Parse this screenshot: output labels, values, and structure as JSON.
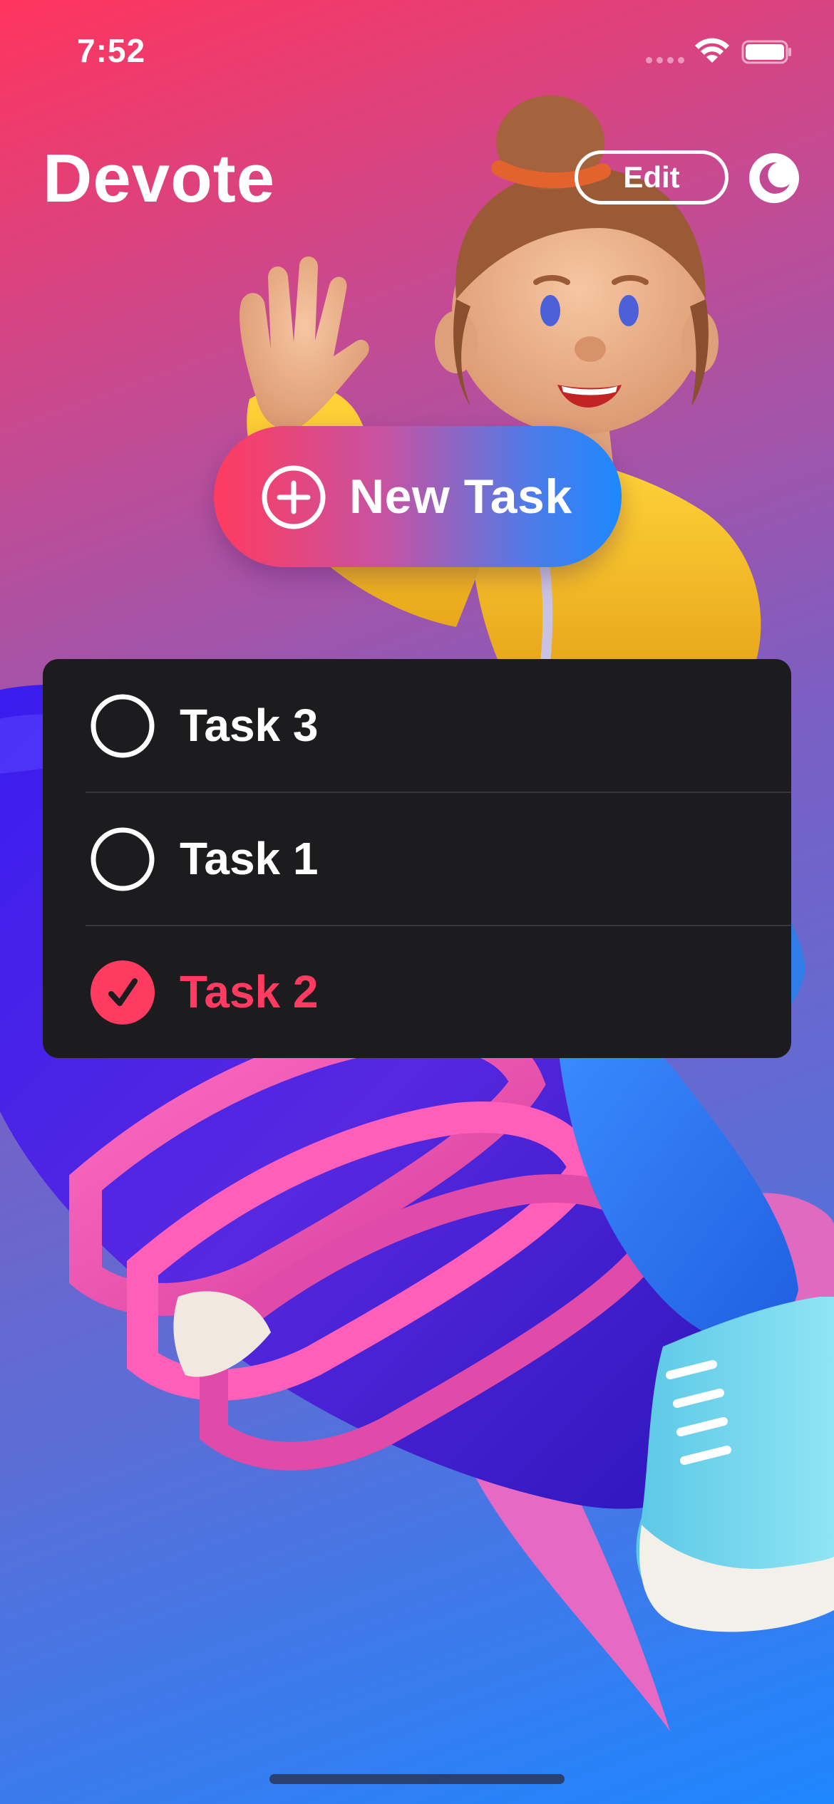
{
  "status_bar": {
    "time": "7:52",
    "signal_icon": "signal-dots-icon",
    "wifi_icon": "wifi-icon",
    "battery_icon": "battery-icon"
  },
  "header": {
    "title": "Devote",
    "edit_label": "Edit",
    "theme_toggle_icon": "moon-icon"
  },
  "new_task": {
    "label": "New Task",
    "icon": "plus-circle-icon"
  },
  "tasks": [
    {
      "label": "Task 3",
      "completed": false
    },
    {
      "label": "Task 1",
      "completed": false
    },
    {
      "label": "Task 2",
      "completed": true
    }
  ],
  "colors": {
    "accent": "#ff3b61",
    "gradient_start": "#ff355e",
    "gradient_end": "#1e86ff",
    "list_background": "#1c1c1e"
  }
}
